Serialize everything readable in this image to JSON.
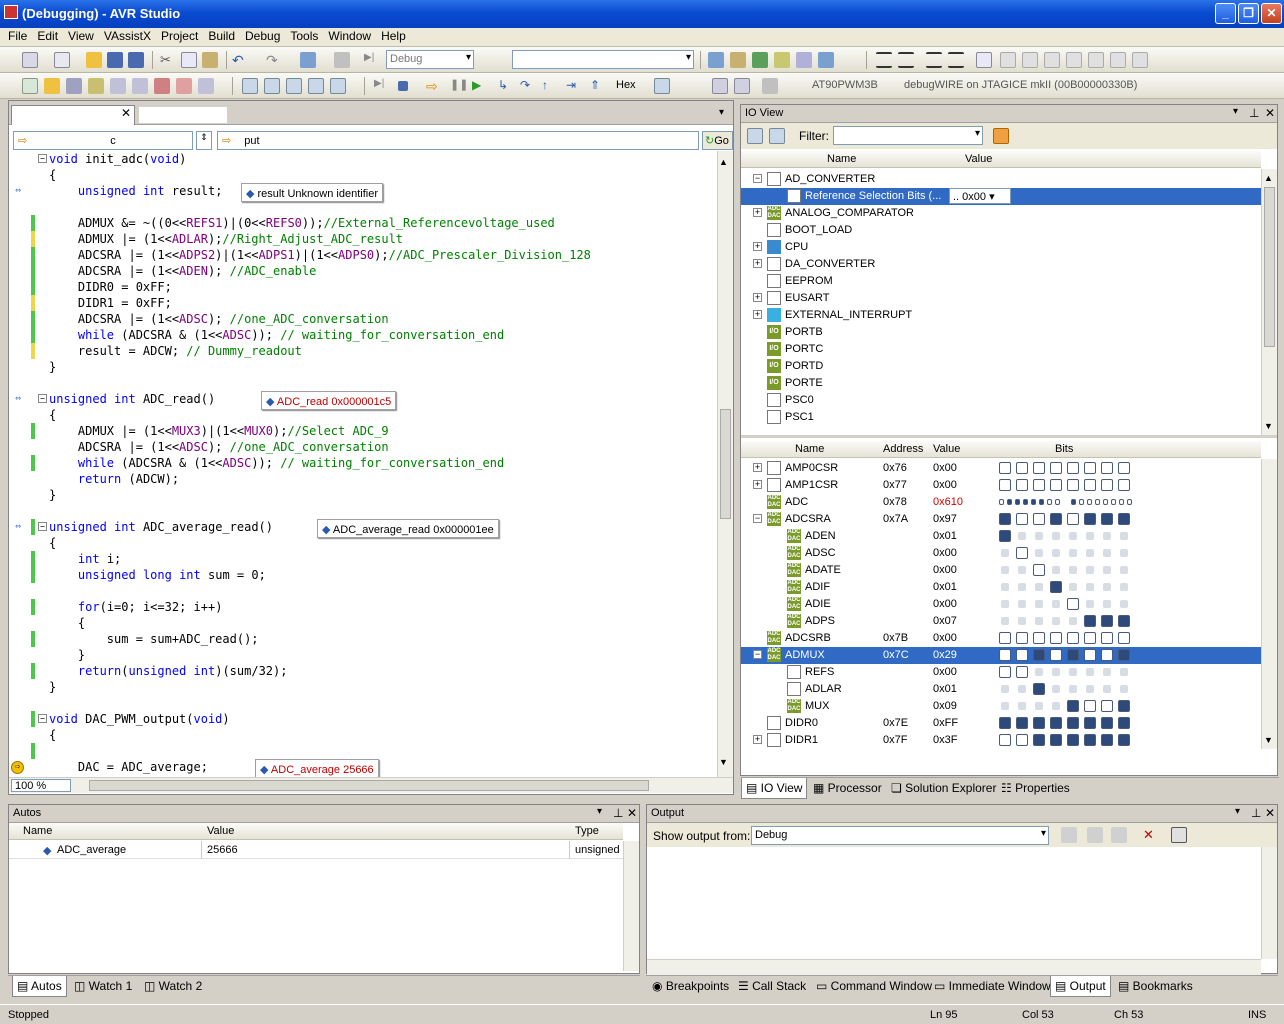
{
  "window": {
    "title": "(Debugging) - AVR Studio",
    "buttons": [
      "_",
      "❐",
      "✕"
    ]
  },
  "menu": [
    "File",
    "Edit",
    "View",
    "VAssistX",
    "Project",
    "Build",
    "Debug",
    "Tools",
    "Window",
    "Help"
  ],
  "toolbar": {
    "config": "Debug",
    "hex_label": "Hex",
    "device": "AT90PWM3B",
    "connection": "debugWIRE on JTAGICE mkII (00B00000330B)"
  },
  "editor": {
    "nav_left": "c",
    "nav_right": "put",
    "go_label": "Go",
    "zoom": "100 %"
  },
  "code_lines": [
    {
      "t": "void init_adc(void)"
    },
    {
      "t": "{"
    },
    {
      "t": "    unsigned int result;"
    },
    {
      "t": ""
    },
    {
      "t": "    ADMUX &= ~((0<<REFS1)|(0<<REFS0));//External_Referencevoltage_used"
    },
    {
      "t": "    ADMUX |= (1<<ADLAR);//Right_Adjust_ADC_result"
    },
    {
      "t": "    ADCSRA |= (1<<ADPS2)|(1<<ADPS1)|(1<<ADPS0);//ADC_Prescaler_Division_128"
    },
    {
      "t": "    ADCSRA |= (1<<ADEN); //ADC_enable"
    },
    {
      "t": "    DIDR0 = 0xFF;"
    },
    {
      "t": "    DIDR1 = 0xFF;"
    },
    {
      "t": "    ADCSRA |= (1<<ADSC); //one_ADC_conversation"
    },
    {
      "t": "    while (ADCSRA & (1<<ADSC)); // waiting_for_conversation_end"
    },
    {
      "t": "    result = ADCW; // Dummy_readout"
    },
    {
      "t": "}"
    },
    {
      "t": ""
    },
    {
      "t": "unsigned int ADC_read()"
    },
    {
      "t": "{"
    },
    {
      "t": "    ADMUX |= (1<<MUX3)|(1<<MUX0);//Select ADC_9"
    },
    {
      "t": "    ADCSRA |= (1<<ADSC); //one_ADC_conversation"
    },
    {
      "t": "    while (ADCSRA & (1<<ADSC)); // waiting_for_conversation_end"
    },
    {
      "t": "    return (ADCW);"
    },
    {
      "t": "}"
    },
    {
      "t": ""
    },
    {
      "t": "unsigned int ADC_average_read()"
    },
    {
      "t": "{"
    },
    {
      "t": "    int i;"
    },
    {
      "t": "    unsigned long int sum = 0;"
    },
    {
      "t": ""
    },
    {
      "t": "    for(i=0; i<=32; i++)"
    },
    {
      "t": "    {"
    },
    {
      "t": "        sum = sum+ADC_read();"
    },
    {
      "t": "    }"
    },
    {
      "t": "    return(unsigned int)(sum/32);"
    },
    {
      "t": "}"
    },
    {
      "t": ""
    },
    {
      "t": "void DAC_PWM_output(void)"
    },
    {
      "t": "{"
    },
    {
      "t": ""
    },
    {
      "t": "    DAC = ADC_average;"
    }
  ],
  "tooltips": [
    {
      "name": "result",
      "value": "Unknown identifier"
    },
    {
      "name": "ADC_read",
      "value": "0x000001c5"
    },
    {
      "name": "ADC_average_read",
      "value": "0x000001ee"
    },
    {
      "name": "ADC_average",
      "value": "25666"
    }
  ],
  "ioview": {
    "title": "IO View",
    "filter_label": "Filter:",
    "col_name": "Name",
    "col_value": "Value",
    "modules": [
      {
        "name": "AD_CONVERTER",
        "icon": "doc-icon",
        "exp": "−"
      },
      {
        "name": "Reference Selection Bits (...",
        "icon": "doc-icon",
        "value": ".. 0x00"
      },
      {
        "name": "ANALOG_COMPARATOR",
        "icon": "adc-dac-icon",
        "exp": "+"
      },
      {
        "name": "BOOT_LOAD",
        "icon": "doc-icon"
      },
      {
        "name": "CPU",
        "icon": "cpu-icon",
        "exp": "+"
      },
      {
        "name": "DA_CONVERTER",
        "icon": "doc-icon",
        "exp": "+"
      },
      {
        "name": "EEPROM",
        "icon": "doc-icon"
      },
      {
        "name": "EUSART",
        "icon": "doc-icon",
        "exp": "+"
      },
      {
        "name": "EXTERNAL_INTERRUPT",
        "icon": "interrupt-icon",
        "exp": "+"
      },
      {
        "name": "PORTB",
        "icon": "io-icon"
      },
      {
        "name": "PORTC",
        "icon": "io-icon"
      },
      {
        "name": "PORTD",
        "icon": "io-icon"
      },
      {
        "name": "PORTE",
        "icon": "io-icon"
      },
      {
        "name": "PSC0",
        "icon": "doc-icon"
      },
      {
        "name": "PSC1",
        "icon": "doc-icon"
      }
    ],
    "reg_cols": {
      "name": "Name",
      "address": "Address",
      "value": "Value",
      "bits": "Bits"
    },
    "registers": [
      {
        "name": "AMP0CSR",
        "addr": "0x76",
        "val": "0x00",
        "exp": "+",
        "icon": "doc-icon",
        "bits": "00000000",
        "lvl": 0
      },
      {
        "name": "AMP1CSR",
        "addr": "0x77",
        "val": "0x00",
        "exp": "+",
        "icon": "doc-icon",
        "bits": "00000000",
        "lvl": 0
      },
      {
        "name": "ADC",
        "addr": "0x78",
        "val": "0x610",
        "red": true,
        "icon": "adc-dac-icon",
        "bits": "adc",
        "lvl": 0
      },
      {
        "name": "ADCSRA",
        "addr": "0x7A",
        "val": "0x97",
        "exp": "−",
        "icon": "adc-dac-icon",
        "bits": "10010111",
        "lvl": 0
      },
      {
        "name": "ADEN",
        "addr": "",
        "val": "0x01",
        "icon": "adc-dac-icon",
        "bits": "1-------",
        "lvl": 1
      },
      {
        "name": "ADSC",
        "addr": "",
        "val": "0x00",
        "icon": "adc-dac-icon",
        "bits": "-0------",
        "lvl": 1
      },
      {
        "name": "ADATE",
        "addr": "",
        "val": "0x00",
        "icon": "adc-dac-icon",
        "bits": "--0-----",
        "lvl": 1
      },
      {
        "name": "ADIF",
        "addr": "",
        "val": "0x01",
        "icon": "adc-dac-icon",
        "bits": "---1----",
        "lvl": 1
      },
      {
        "name": "ADIE",
        "addr": "",
        "val": "0x00",
        "icon": "adc-dac-icon",
        "bits": "----0---",
        "lvl": 1
      },
      {
        "name": "ADPS",
        "addr": "",
        "val": "0x07",
        "icon": "adc-dac-icon",
        "bits": "-----111",
        "lvl": 1
      },
      {
        "name": "ADCSRB",
        "addr": "0x7B",
        "val": "0x00",
        "icon": "adc-dac-icon",
        "bits": "00000000",
        "lvl": 0
      },
      {
        "name": "ADMUX",
        "addr": "0x7C",
        "val": "0x29",
        "exp": "−",
        "icon": "adc-dac-icon",
        "bits": "00101001",
        "lvl": 0,
        "sel": true
      },
      {
        "name": "REFS",
        "addr": "",
        "val": "0x00",
        "icon": "doc-icon",
        "bits": "00------",
        "lvl": 1
      },
      {
        "name": "ADLAR",
        "addr": "",
        "val": "0x01",
        "icon": "doc-icon",
        "bits": "--1-----",
        "lvl": 1
      },
      {
        "name": "MUX",
        "addr": "",
        "val": "0x09",
        "icon": "adc-dac-icon",
        "bits": "----1001",
        "lvl": 1
      },
      {
        "name": "DIDR0",
        "addr": "0x7E",
        "val": "0xFF",
        "icon": "doc-icon",
        "bits": "11111111",
        "lvl": 0
      },
      {
        "name": "DIDR1",
        "addr": "0x7F",
        "val": "0x3F",
        "exp": "+",
        "icon": "doc-icon",
        "bits": "00111111",
        "lvl": 0
      }
    ],
    "tabs": [
      "IO View",
      "Processor",
      "Solution Explorer",
      "Properties"
    ]
  },
  "autos": {
    "title": "Autos",
    "cols": [
      "Name",
      "Value",
      "Type"
    ],
    "rows": [
      {
        "name": "ADC_average",
        "value": "25666",
        "type": "unsigned"
      }
    ],
    "tabs": [
      "Autos",
      "Watch 1",
      "Watch 2"
    ]
  },
  "output": {
    "title": "Output",
    "show_label": "Show output from:",
    "source": "Debug",
    "tabs": [
      "Breakpoints",
      "Call Stack",
      "Command Window",
      "Immediate Window",
      "Output",
      "Bookmarks"
    ]
  },
  "status": {
    "text": "Stopped",
    "ln": "Ln 95",
    "col": "Col 53",
    "ch": "Ch 53",
    "mode": "INS"
  }
}
